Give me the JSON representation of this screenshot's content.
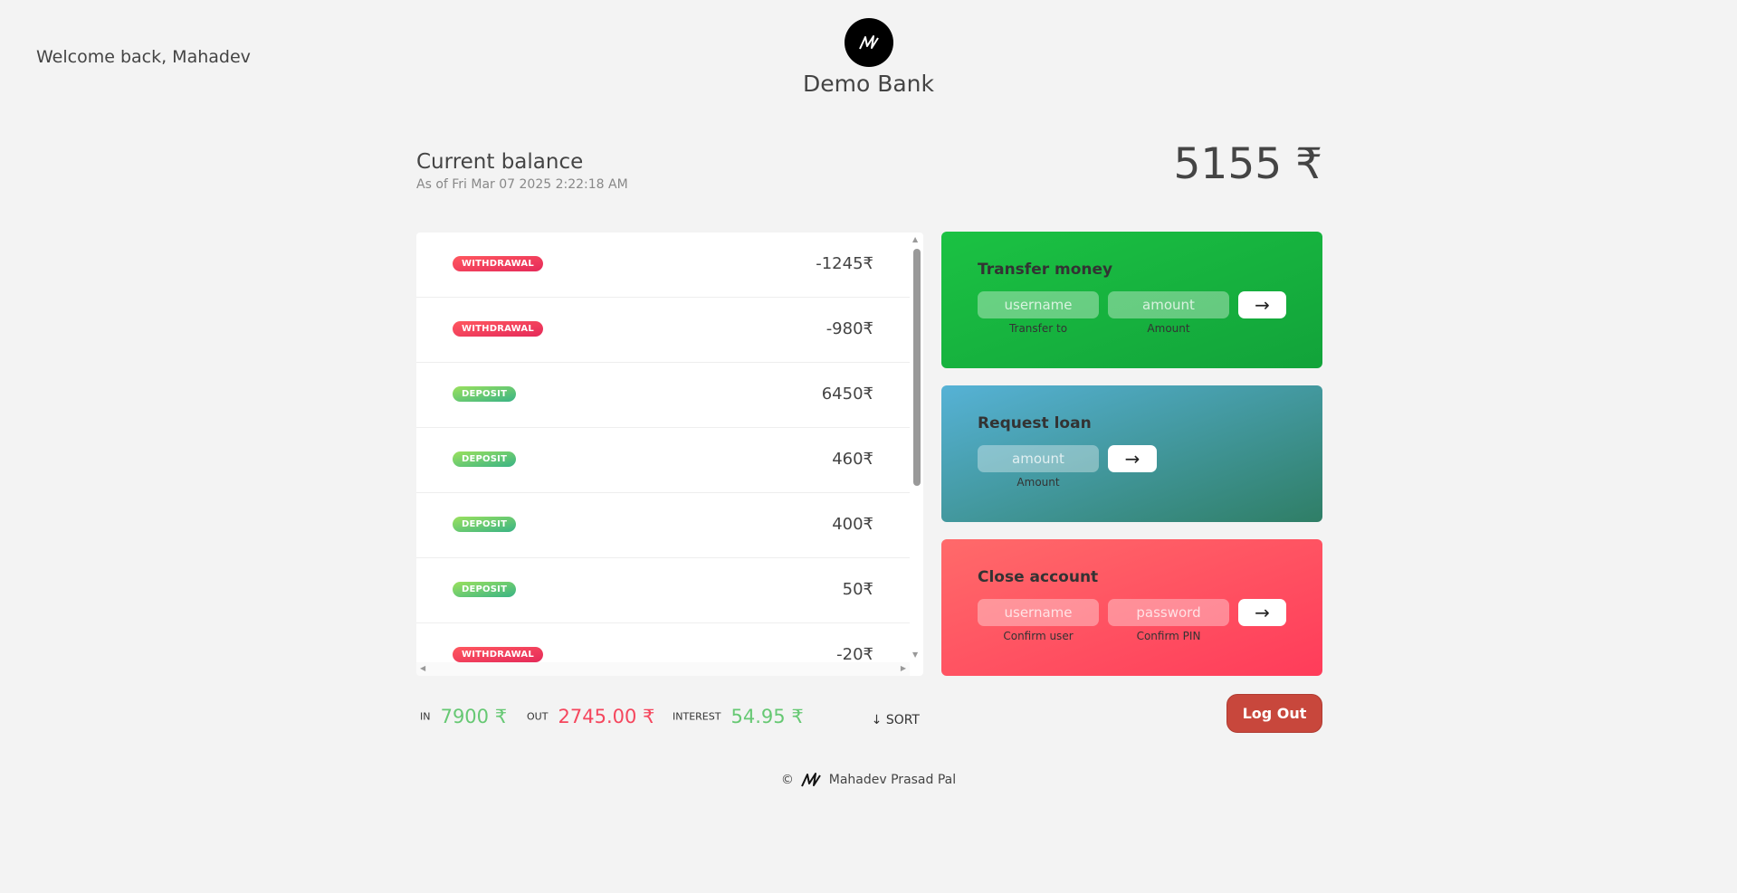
{
  "header": {
    "welcome": "Welcome back, Mahadev",
    "brand_name": "Demo Bank",
    "logo_icon": "bank-logo-icon"
  },
  "balance": {
    "label": "Current balance",
    "date": "As of Fri Mar 07 2025 2:22:18 AM",
    "value": "5155 ₹"
  },
  "movements": [
    {
      "type": "withdrawal",
      "label": "WITHDRAWAL",
      "value": "-1245₹"
    },
    {
      "type": "withdrawal",
      "label": "WITHDRAWAL",
      "value": "-980₹"
    },
    {
      "type": "deposit",
      "label": "DEPOSIT",
      "value": "6450₹"
    },
    {
      "type": "deposit",
      "label": "DEPOSIT",
      "value": "460₹"
    },
    {
      "type": "deposit",
      "label": "DEPOSIT",
      "value": "400₹"
    },
    {
      "type": "deposit",
      "label": "DEPOSIT",
      "value": "50₹"
    },
    {
      "type": "withdrawal",
      "label": "WITHDRAWAL",
      "value": "-20₹"
    }
  ],
  "summary": {
    "in_label": "IN",
    "in_value": "7900 ₹",
    "out_label": "OUT",
    "out_value": "2745.00 ₹",
    "interest_label": "INTEREST",
    "interest_value": "54.95 ₹",
    "sort_label": "↓ SORT"
  },
  "transfer": {
    "title": "Transfer money",
    "to_placeholder": "username",
    "to_caption": "Transfer to",
    "amount_placeholder": "amount",
    "amount_caption": "Amount",
    "button": "→"
  },
  "loan": {
    "title": "Request loan",
    "amount_placeholder": "amount",
    "amount_caption": "Amount",
    "button": "→"
  },
  "close": {
    "title": "Close account",
    "user_placeholder": "username",
    "user_caption": "Confirm user",
    "pin_placeholder": "password",
    "pin_caption": "Confirm PIN",
    "button": "→"
  },
  "logout_label": "Log Out",
  "footer": {
    "copyright": "©",
    "author": "Mahadev Prasad Pal"
  },
  "colors": {
    "withdrawal": "#ff585f",
    "deposit": "#39b385",
    "in": "#66c873",
    "out": "#f5465d",
    "logout": "#c8473c"
  }
}
